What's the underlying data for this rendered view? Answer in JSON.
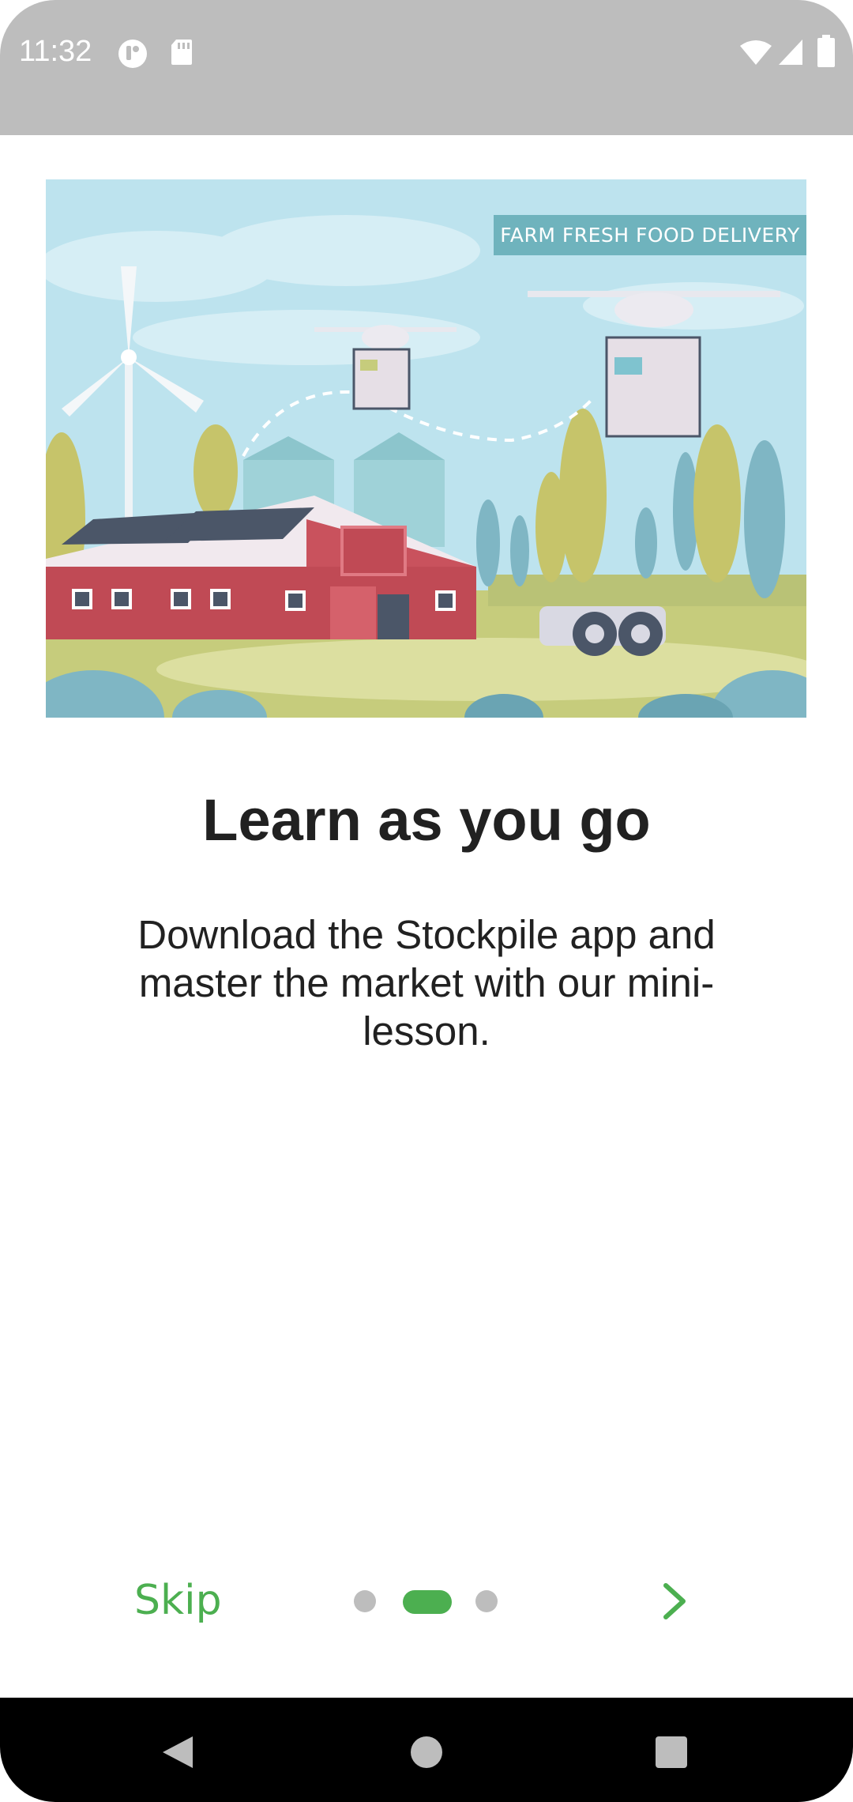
{
  "status_bar": {
    "time": "11:32",
    "icons": [
      "theme-icon",
      "sd-card-icon",
      "wifi-icon",
      "signal-icon",
      "battery-icon"
    ]
  },
  "hero": {
    "banner_text": "FARM FRESH FOOD DELIVERY",
    "illustration": "farm-drone-delivery-illustration"
  },
  "onboarding": {
    "title": "Learn as you go",
    "description": "Download the Stockpile app and master the market with our mini-lesson."
  },
  "footer": {
    "skip_label": "Skip",
    "page_count": 3,
    "current_page": 2,
    "next_icon": "chevron-right-icon"
  },
  "nav_bar": {
    "buttons": [
      "back-icon",
      "home-icon",
      "recents-icon"
    ]
  },
  "colors": {
    "accent": "#4caf50",
    "status_bar": "#bdbdbd",
    "text": "#212121",
    "dot_inactive": "#bdbdbd"
  }
}
